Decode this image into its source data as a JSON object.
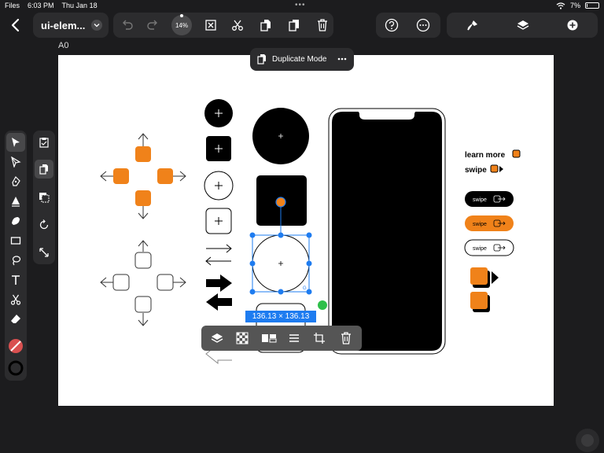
{
  "status_bar": {
    "app": "Files",
    "time": "6:03 PM",
    "date": "Thu Jan 18",
    "battery_percent": "7%",
    "battery_level": 0.07
  },
  "toolbar": {
    "document_title": "ui-elem...",
    "zoom_label": "14%",
    "icons": [
      "back-icon",
      "undo-icon",
      "redo-icon",
      "deselect-icon",
      "scissors-icon",
      "duplicate-icon",
      "paste-icon",
      "trash-icon",
      "help-icon",
      "more-icon",
      "brush-icon",
      "layers-icon",
      "add-icon"
    ]
  },
  "canvas": {
    "artboard_label": "A0",
    "mode_label": "Duplicate Mode",
    "selection_dimensions": "136.13 × 136.13",
    "selection_handle_label": "G",
    "pill_buttons": [
      "swipe",
      "swipe",
      "swipe"
    ],
    "link_texts": [
      "learn more",
      "swipe"
    ],
    "accent_color": "#f0821a",
    "selection_color": "#1e7cf0"
  },
  "left_tools": {
    "primary": [
      "select-arrow-icon",
      "direct-select-icon",
      "pen-icon",
      "vector-tool-icon",
      "shape-builder-icon",
      "rectangle-icon",
      "lasso-icon",
      "text-icon",
      "scissors-icon",
      "eraser-icon",
      "fill-none-swatch",
      "stroke-swatch"
    ],
    "secondary": [
      "clipboard-icon",
      "duplicate-icon",
      "transform-icon",
      "rotate-icon",
      "scale-icon"
    ]
  },
  "selection_toolbar": {
    "icons": [
      "layers-icon",
      "checkerboard-icon",
      "swap-icon",
      "align-icon",
      "crop-icon",
      "trash-icon"
    ]
  }
}
